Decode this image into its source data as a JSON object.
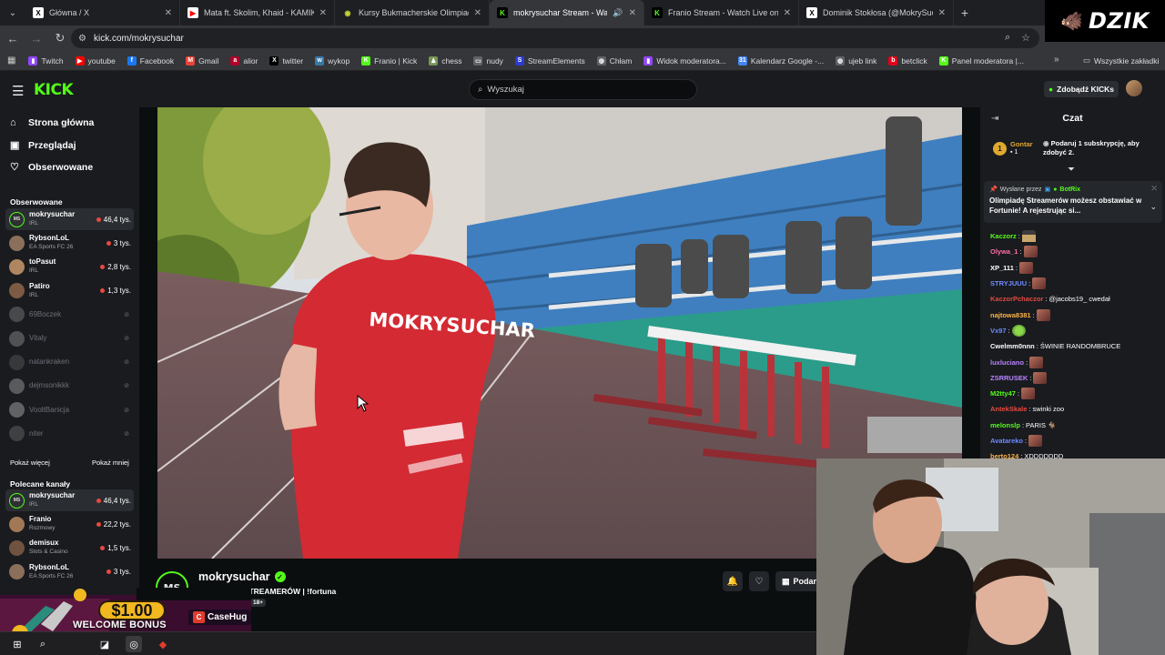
{
  "browser": {
    "tabs": [
      {
        "title": "Główna / X",
        "favicon": "x-icon",
        "favicon_glyph": "X",
        "favicon_color": "#000000",
        "active": false
      },
      {
        "title": "Mata ft. Skolim, Khaid - KAMIK",
        "favicon": "youtube-icon",
        "favicon_glyph": "▶",
        "favicon_color": "#ff0000",
        "active": false
      },
      {
        "title": "Kursy Bukmacherskie Olimpiad",
        "favicon": "circle-icon",
        "favicon_glyph": "◉",
        "favicon_color": "#c6d43a",
        "active": false
      },
      {
        "title": "mokrysuchar Stream - Watc",
        "favicon": "kick-icon",
        "favicon_glyph": "K",
        "favicon_color": "#53fc18",
        "active": true
      },
      {
        "title": "Franio Stream - Watch Live on",
        "favicon": "kick-icon",
        "favicon_glyph": "K",
        "favicon_color": "#53fc18",
        "active": false
      },
      {
        "title": "Dominik Stokłosa (@MokrySuc",
        "favicon": "x-icon",
        "favicon_glyph": "X",
        "favicon_color": "#000000",
        "active": false
      }
    ],
    "url": "kick.com/mokrysuchar",
    "bookmarks": [
      {
        "label": "Twitch",
        "icon": "twitch-icon",
        "glyph": "▮",
        "color": "#9146ff"
      },
      {
        "label": "youtube",
        "icon": "youtube-icon",
        "glyph": "▶",
        "color": "#ff0000"
      },
      {
        "label": "Facebook",
        "icon": "facebook-icon",
        "glyph": "f",
        "color": "#1877f2"
      },
      {
        "label": "Gmail",
        "icon": "gmail-icon",
        "glyph": "M",
        "color": "#ea4335"
      },
      {
        "label": "alior",
        "icon": "alior-icon",
        "glyph": "a",
        "color": "#b1002b"
      },
      {
        "label": "twitter",
        "icon": "x-icon",
        "glyph": "X",
        "color": "#000000"
      },
      {
        "label": "wykop",
        "icon": "wykop-icon",
        "glyph": "w",
        "color": "#367aa9"
      },
      {
        "label": "Franio | Kick",
        "icon": "kick-icon",
        "glyph": "K",
        "color": "#53fc18"
      },
      {
        "label": "chess",
        "icon": "chess-icon",
        "glyph": "♟",
        "color": "#769656"
      },
      {
        "label": "nudy",
        "icon": "folder-icon",
        "glyph": "▭",
        "color": "#5f6368"
      },
      {
        "label": "StreamElements",
        "icon": "streamelements-icon",
        "glyph": "S",
        "color": "#2b3bd1"
      },
      {
        "label": "Chłam",
        "icon": "globe-icon",
        "glyph": "◍",
        "color": "#5f6368"
      },
      {
        "label": "Widok moderatora...",
        "icon": "twitch-icon",
        "glyph": "▮",
        "color": "#9146ff"
      },
      {
        "label": "Kalendarz Google -...",
        "icon": "calendar-icon",
        "glyph": "31",
        "color": "#4285f4"
      },
      {
        "label": "ujeb link",
        "icon": "globe-icon",
        "glyph": "◍",
        "color": "#5f6368"
      },
      {
        "label": "betclick",
        "icon": "betclick-icon",
        "glyph": "b",
        "color": "#e2001a"
      },
      {
        "label": "Panel moderatora |...",
        "icon": "kick-icon",
        "glyph": "K",
        "color": "#53fc18"
      }
    ],
    "all_bookmarks": "Wszystkie zakładki"
  },
  "overlay": {
    "dzik": "DZIK",
    "ad": {
      "amount": "$1.00",
      "bonus": "WELCOME BONUS",
      "brand": "CaseHug"
    }
  },
  "kick": {
    "logo": "KICK",
    "search_placeholder": "Wyszukaj",
    "get_kicks": "Zdobądź KICKs",
    "nav": [
      {
        "label": "Strona główna",
        "icon": "home-icon",
        "glyph": "⌂"
      },
      {
        "label": "Przeglądaj",
        "icon": "browse-icon",
        "glyph": "▣"
      },
      {
        "label": "Obserwowane",
        "icon": "heart-icon",
        "glyph": "♡"
      }
    ],
    "followed_title": "Obserwowane",
    "followed": [
      {
        "name": "mokrysuchar",
        "category": "IRL",
        "viewers": "46,4 tys.",
        "live": true,
        "highlight": true,
        "avatar": "#2d2f33",
        "avatar_text": "MS"
      },
      {
        "name": "RybsonLoL",
        "category": "EA Sports FC 26",
        "viewers": "3 tys.",
        "live": true,
        "avatar": "#8a6f5a"
      },
      {
        "name": "toPasut",
        "category": "IRL",
        "viewers": "2,8 tys.",
        "live": true,
        "avatar": "#b08660"
      },
      {
        "name": "Patiro",
        "category": "IRL",
        "viewers": "1,3 tys.",
        "live": true,
        "avatar": "#7d5a44"
      },
      {
        "name": "69Boczek",
        "live": false,
        "avatar": "#777"
      },
      {
        "name": "Vitaly",
        "live": false,
        "avatar": "#888"
      },
      {
        "name": "natankraken",
        "live": false,
        "avatar": "#555"
      },
      {
        "name": "dejmsonikkk",
        "live": false,
        "avatar": "#999"
      },
      {
        "name": "VooltBanicja",
        "live": false,
        "avatar": "#aaa"
      },
      {
        "name": "niter",
        "live": false,
        "avatar": "#666"
      }
    ],
    "show_more": "Pokaż więcej",
    "show_less": "Pokaż mniej",
    "recommended_title": "Polecane kanały",
    "recommended": [
      {
        "name": "mokrysuchar",
        "category": "IRL",
        "viewers": "46,4 tys.",
        "live": true,
        "highlight": true,
        "avatar": "#2d2f33",
        "avatar_text": "MS"
      },
      {
        "name": "Franio",
        "category": "Rozmowy",
        "viewers": "22,2 tys.",
        "live": true,
        "avatar": "#a17855"
      },
      {
        "name": "demisux",
        "category": "Slots & Casino",
        "viewers": "1,5 tys.",
        "live": true,
        "avatar": "#6f5240"
      },
      {
        "name": "RybsonLoL",
        "category": "EA Sports FC 26",
        "viewers": "3 tys.",
        "live": true,
        "avatar": "#8a6f5a"
      }
    ],
    "channel": {
      "logo_text": "MS",
      "name": "mokrysuchar",
      "title": "OLIMPIADA STREAMERÓW | !fortuna",
      "age": "18+",
      "gift_label": "Podar"
    },
    "jersey_text": "MOKRYSUCHAR",
    "chat": {
      "title": "Czat",
      "top_gifter": {
        "rank": "1",
        "name": "Gontar",
        "count": "1"
      },
      "gift_cta": "Podaruj 1 subskrypcję, aby zdobyć 2.",
      "pinned": {
        "sent_by": "Wysłane przez",
        "author": "BotRix",
        "message": "Olimpiadę Streamerów możesz obstawiać w Fortunie! A rejestrując si..."
      },
      "messages": [
        {
          "user": "Kaczorz",
          "color": "#53fc18",
          "text": "",
          "emote": "hat"
        },
        {
          "user": "Olywa_1",
          "color": "#ff6fa7",
          "text": "",
          "emote": "face"
        },
        {
          "user": "XP_111",
          "color": "#ffffff",
          "text": "",
          "emote": "face"
        },
        {
          "user": "STRYJUUU",
          "color": "#6f8bff",
          "text": "",
          "emote": "face"
        },
        {
          "user": "KaczorPchaczor",
          "color": "#e8493f",
          "text": "@jacobs19_ cwedał",
          "emote": ""
        },
        {
          "user": "najtowa8381",
          "color": "#ffb347",
          "text": "",
          "emote": "face"
        },
        {
          "user": "Vx97",
          "color": "#6f8bff",
          "text": "",
          "emote": "green"
        },
        {
          "user": "Cwelmm0nnn",
          "color": "#ffffff",
          "text": "ŚWINIE RANDOMBRUCE",
          "emote": ""
        },
        {
          "user": "luxluciano",
          "color": "#b983ff",
          "text": "",
          "emote": "face"
        },
        {
          "user": "ZSRRUSEK",
          "color": "#b983ff",
          "text": "",
          "emote": "face"
        },
        {
          "user": "M2tty47",
          "color": "#53fc18",
          "text": "",
          "emote": "face"
        },
        {
          "user": "AntekSkale",
          "color": "#e8493f",
          "text": "swinki zoo",
          "emote": ""
        },
        {
          "user": "melonslp",
          "color": "#53fc18",
          "text": "PARIS 🐐",
          "emote": ""
        },
        {
          "user": "Avatareko",
          "color": "#6f8bff",
          "text": "",
          "emote": "face"
        },
        {
          "user": "berto124",
          "color": "#ffb347",
          "text": "XDDDDDDD",
          "emote": ""
        }
      ]
    }
  }
}
